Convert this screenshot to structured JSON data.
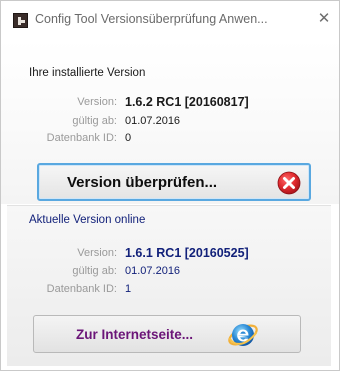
{
  "window": {
    "title": "Config Tool Versionsüberprüfung Anwen...",
    "close_glyph": "✕"
  },
  "installed": {
    "heading": "Ihre installierte Version",
    "version_label": "Version:",
    "version_value": "1.6.2 RC1 [20160817]",
    "valid_label": "gültig ab:",
    "valid_value": "01.07.2016",
    "db_label": "Datenbank ID:",
    "db_value": "0"
  },
  "check_button": {
    "label": "Version überprüfen...",
    "icon": "error-x-icon",
    "icon_color": "#d7262c"
  },
  "online": {
    "heading": "Aktuelle Version online",
    "version_label": "Version:",
    "version_value": "1.6.1 RC1 [20160525]",
    "valid_label": "gültig ab:",
    "valid_value": "01.07.2016",
    "db_label": "Datenbank ID:",
    "db_value": "1",
    "value_color": "#12217a"
  },
  "web_button": {
    "label": "Zur Internetseite...",
    "icon": "internet-explorer-icon",
    "label_color": "#6b1578"
  },
  "colors": {
    "focus_border": "#59a8e0",
    "online_heading": "#12217a"
  }
}
